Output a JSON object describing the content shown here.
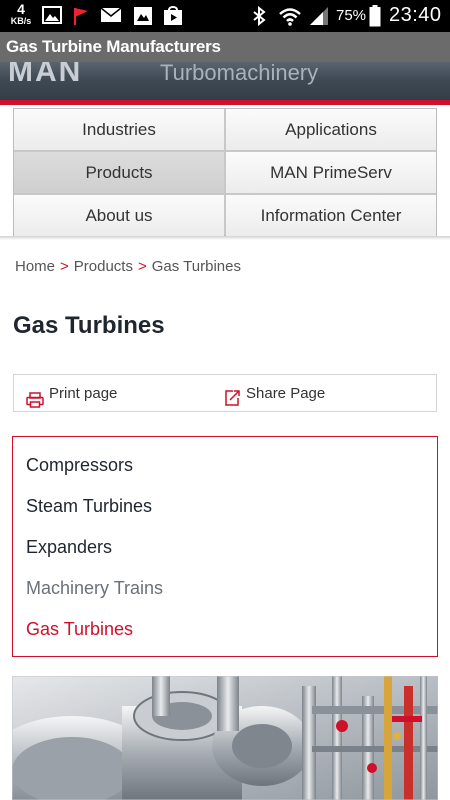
{
  "status_bar": {
    "speed_value": "4",
    "speed_unit": "KB/s",
    "battery_percent": "75%",
    "time": "23:40",
    "icons": [
      "image-icon",
      "flag-icon",
      "mail-icon",
      "gallery-icon",
      "play-store-icon",
      "bluetooth-icon",
      "wifi-icon",
      "signal-icon",
      "battery-icon"
    ]
  },
  "app": {
    "title": "Gas Turbine Manufacturers"
  },
  "header": {
    "logo": "MAN",
    "tagline": "Turbomachinery",
    "accent_color": "#d0102a"
  },
  "nav": {
    "items": [
      {
        "label": "Industries"
      },
      {
        "label": "Applications"
      },
      {
        "label": "Products"
      },
      {
        "label": "MAN PrimeServ"
      },
      {
        "label": "About us"
      },
      {
        "label": "Information Center"
      }
    ],
    "active": "Products"
  },
  "breadcrumb": {
    "items": [
      "Home",
      "Products",
      "Gas Turbines"
    ],
    "separator": ">"
  },
  "page": {
    "title": "Gas Turbines"
  },
  "tools": {
    "print_label": "Print page",
    "share_label": "Share Page"
  },
  "products": {
    "items": [
      {
        "label": "Compressors"
      },
      {
        "label": "Steam Turbines"
      },
      {
        "label": "Expanders"
      },
      {
        "label": "Machinery Trains"
      },
      {
        "label": "Gas Turbines"
      }
    ],
    "current": "Gas Turbines"
  }
}
